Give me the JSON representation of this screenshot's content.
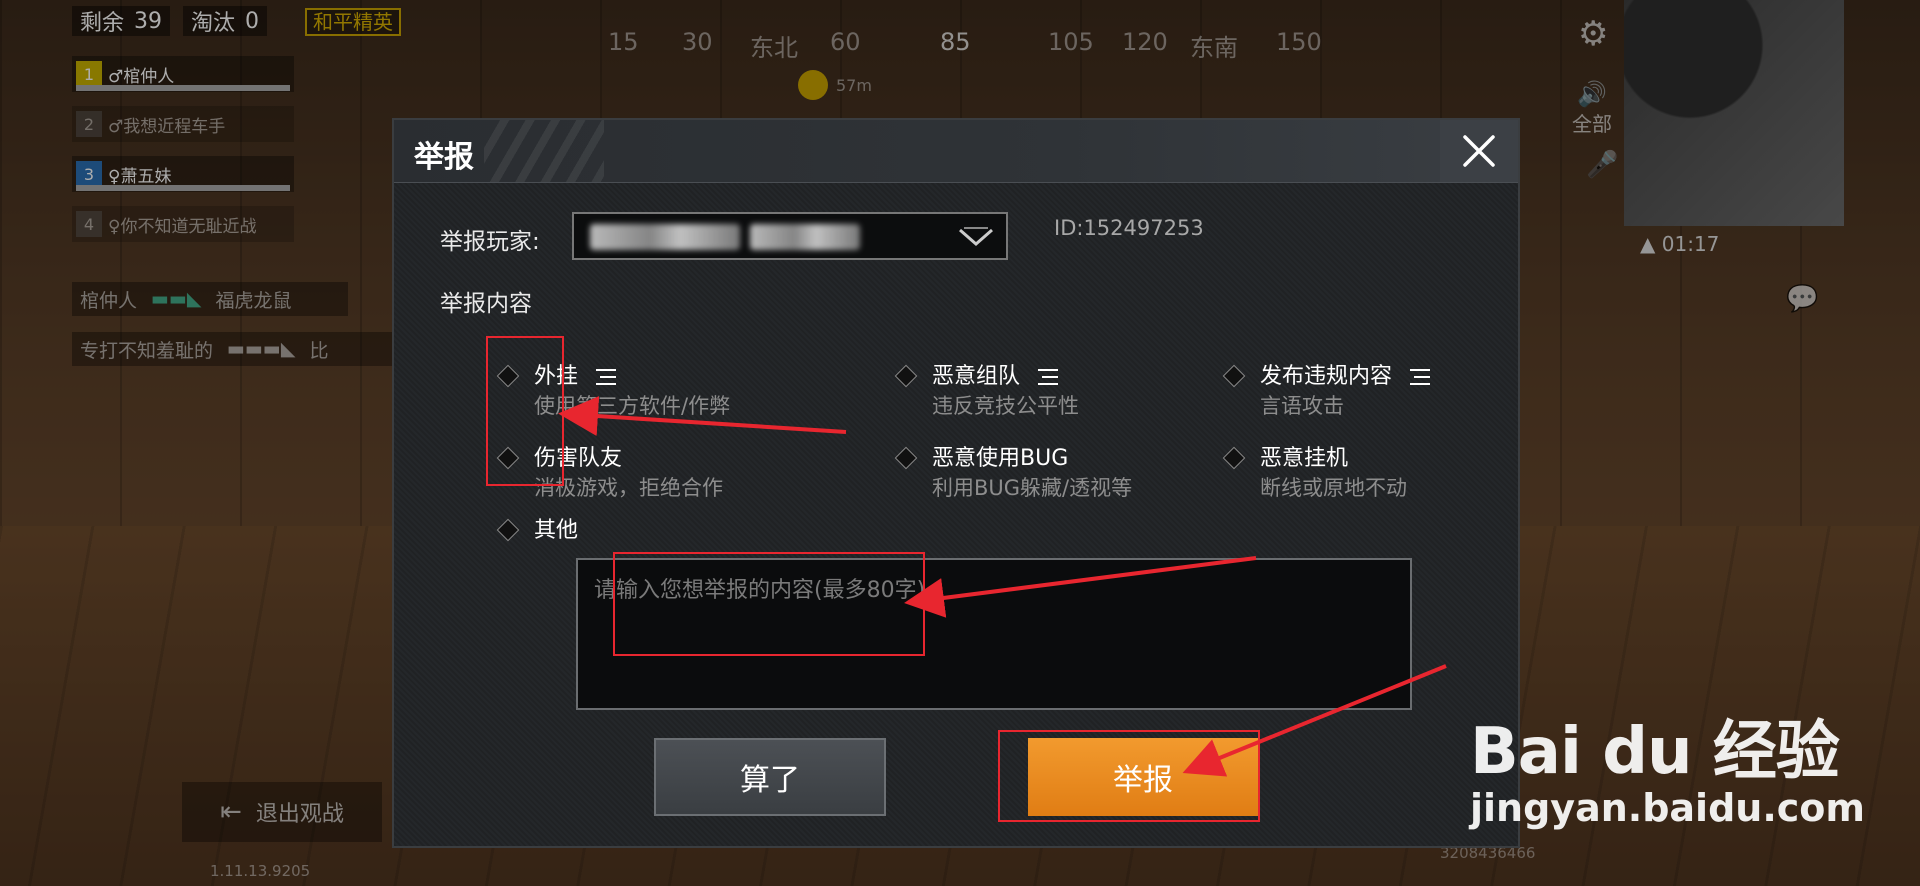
{
  "hud": {
    "remaining_label": "剩余",
    "remaining_value": "39",
    "eliminated_label": "淘汰",
    "eliminated_value": "0",
    "mode_badge": "和平精英",
    "compass_ticks": [
      "15",
      "30",
      "东北",
      "60",
      "85",
      "105",
      "120",
      "东南",
      "150"
    ],
    "marker_distance": "57m",
    "team": [
      {
        "num": "1",
        "name": "♂棺仲人"
      },
      {
        "num": "2",
        "name": "♂我想近程车手"
      },
      {
        "num": "3",
        "name": "♀萧五妹"
      },
      {
        "num": "4",
        "name": "♀你不知道无耻近战"
      }
    ],
    "killfeed": [
      {
        "killer": "棺仲人",
        "victim": "福虎龙鼠"
      },
      {
        "killer": "专打不知羞耻的",
        "victim": "比"
      }
    ],
    "side_buttons": {
      "voice_all": "全部"
    },
    "timer": "01:17",
    "exit_spectate": "退出观战",
    "bottom_info": "1.11.13.9205",
    "bottom_id": "3208436466"
  },
  "dialog": {
    "title": "举报",
    "player_label": "举报玩家:",
    "player_id": "ID:152497253",
    "content_label": "举报内容",
    "options": [
      {
        "title": "外挂",
        "desc": "使用第三方软件/作弊",
        "has_menu": true
      },
      {
        "title": "恶意组队",
        "desc": "违反竞技公平性",
        "has_menu": true
      },
      {
        "title": "发布违规内容",
        "desc": "言语攻击",
        "has_menu": true
      },
      {
        "title": "伤害队友",
        "desc": "消极游戏，拒绝合作",
        "has_menu": false
      },
      {
        "title": "恶意使用BUG",
        "desc": "利用BUG躲藏/透视等",
        "has_menu": false
      },
      {
        "title": "恶意挂机",
        "desc": "断线或原地不动",
        "has_menu": false
      },
      {
        "title": "其他",
        "desc": "",
        "has_menu": false
      }
    ],
    "textarea_placeholder": "请输入您想举报的内容(最多80字)",
    "cancel_label": "算了",
    "report_label": "举报"
  },
  "watermark": {
    "logo": "Bai du 经验",
    "url": "jingyan.baidu.com"
  },
  "colors": {
    "accent_orange": "#e8871c",
    "highlight_red": "#e8262f"
  }
}
